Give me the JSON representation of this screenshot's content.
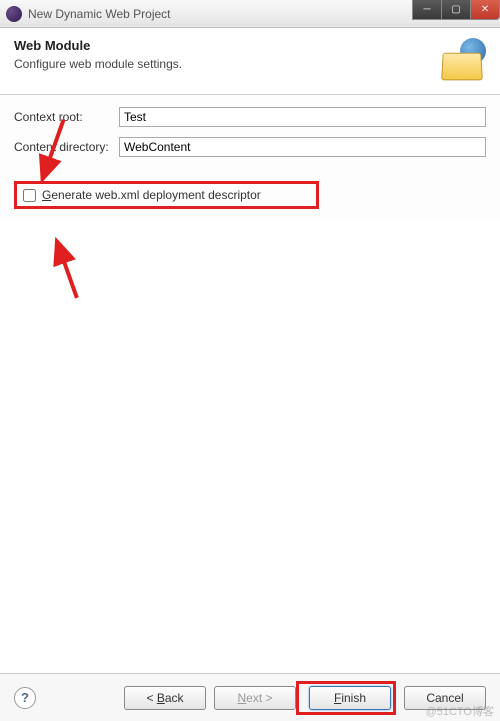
{
  "window": {
    "title": "New Dynamic Web Project"
  },
  "header": {
    "title": "Web Module",
    "subtitle": "Configure web module settings."
  },
  "form": {
    "context_root_label": "Context root:",
    "context_root_value": "Test",
    "content_dir_label": "Content directory:",
    "content_dir_value": "WebContent",
    "generate_webxml_label": "Generate web.xml deployment descriptor",
    "generate_webxml_checked": false
  },
  "buttons": {
    "help": "?",
    "back": "< Back",
    "next": "Next >",
    "finish": "Finish",
    "cancel": "Cancel"
  },
  "watermark": "@51CTO博客"
}
